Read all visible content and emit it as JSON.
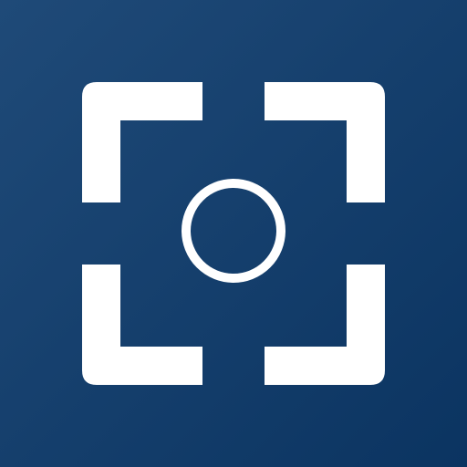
{
  "icon": {
    "name": "scan-focus-icon",
    "colors": {
      "background_start": "#1f4a78",
      "background_end": "#0b3461",
      "foreground": "#ffffff"
    }
  }
}
